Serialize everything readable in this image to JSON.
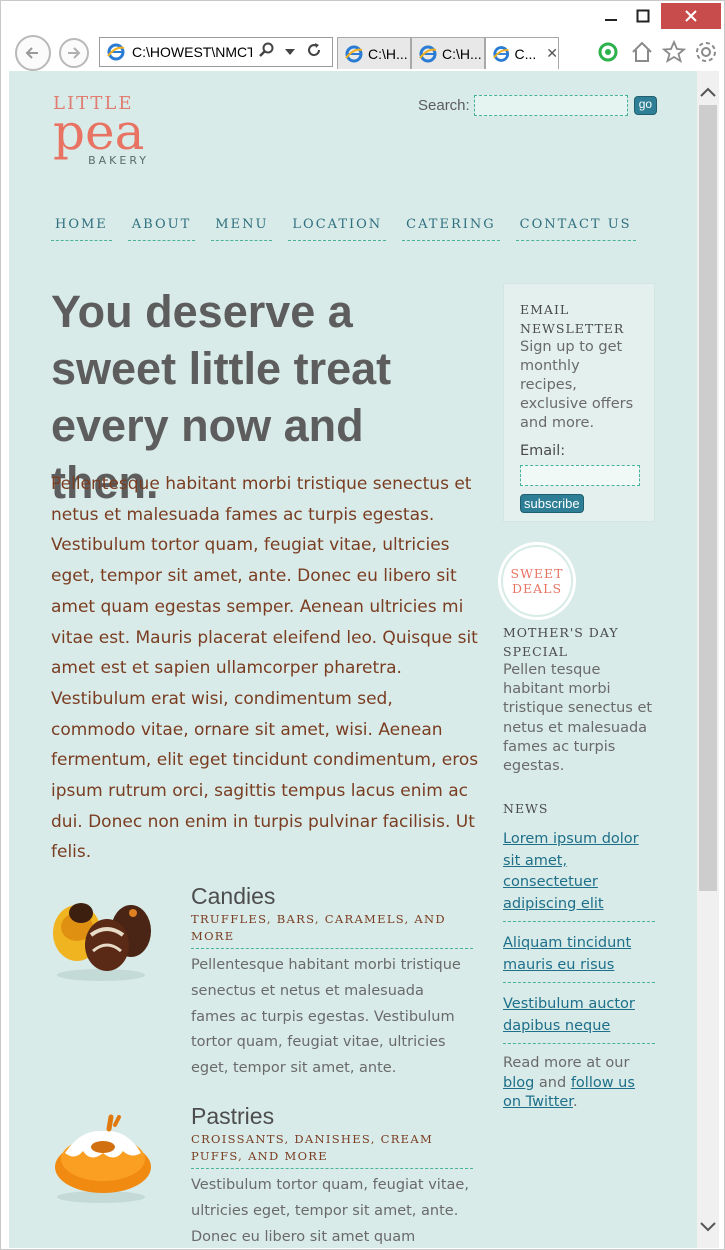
{
  "browser": {
    "address_url": "C:\\HOWEST\\NMCT",
    "tabs": [
      {
        "label": "C:\\H..."
      },
      {
        "label": "C:\\H..."
      },
      {
        "label": "C..."
      }
    ]
  },
  "site": {
    "logo": {
      "line1": "LITTLE",
      "line2": "pea",
      "line3": "BAKERY"
    },
    "search": {
      "label": "Search:",
      "button": "go"
    },
    "nav": [
      "HOME",
      "ABOUT",
      "MENU",
      "LOCATION",
      "CATERING",
      "CONTACT US"
    ],
    "hero": "You deserve a sweet little treat every now and then.",
    "intro": "Pellentesque habitant morbi tristique senectus et netus et malesuada fames ac turpis egestas. Vestibulum tortor quam, feugiat vitae, ultricies eget, tempor sit amet, ante. Donec eu libero sit amet quam egestas semper. Aenean ultricies mi vitae est. Mauris placerat eleifend leo. Quisque sit amet est et sapien ullamcorper pharetra. Vestibulum erat wisi, condimentum sed, commodo vitae, ornare sit amet, wisi. Aenean fermentum, elit eget tincidunt condimentum, eros ipsum rutrum orci, sagittis tempus lacus enim ac dui. Donec non enim in turpis pulvinar facilisis. Ut felis.",
    "products": [
      {
        "title": "Candies",
        "subtitle": "TRUFFLES, BARS, CARAMELS, AND MORE",
        "description": "Pellentesque habitant morbi tristique senectus et netus et malesuada fames ac turpis egestas. Vestibulum tortor quam, feugiat vitae, ultricies eget, tempor sit amet, ante."
      },
      {
        "title": "Pastries",
        "subtitle": "CROISSANTS, DANISHES, CREAM PUFFS, AND MORE",
        "description": "Vestibulum tortor quam, feugiat vitae, ultricies eget, tempor sit amet, ante. Donec eu libero sit amet quam egestas semper."
      }
    ],
    "newsletter": {
      "title": "EMAIL NEWSLETTER",
      "text": "Sign up to get monthly recipes, exclusive offers and more.",
      "email_label": "Email:",
      "button": "subscribe"
    },
    "sweet_deals": {
      "line1": "SWEET",
      "line2": "DEALS"
    },
    "special": {
      "title": "MOTHER'S DAY SPECIAL",
      "text": "Pellen tesque habitant morbi tristique senectus et netus et malesuada fames ac turpis egestas."
    },
    "news": {
      "title": "NEWS",
      "items": [
        "Lorem ipsum dolor sit amet, consectetuer adipiscing elit",
        "Aliquam tincidunt mauris eu risus",
        "Vestibulum auctor dapibus neque"
      ],
      "more_prefix": "Read more at our",
      "blog_link": "blog",
      "more_mid": "and",
      "twitter_link": "follow us on Twitter",
      "more_suffix": "."
    }
  },
  "colors": {
    "page_bg": "#d8ebe8",
    "accent_brown": "#7a3d22",
    "accent_teal": "#2f6f7f",
    "logo_coral": "#e87363",
    "link_blue": "#1e6f8a"
  }
}
